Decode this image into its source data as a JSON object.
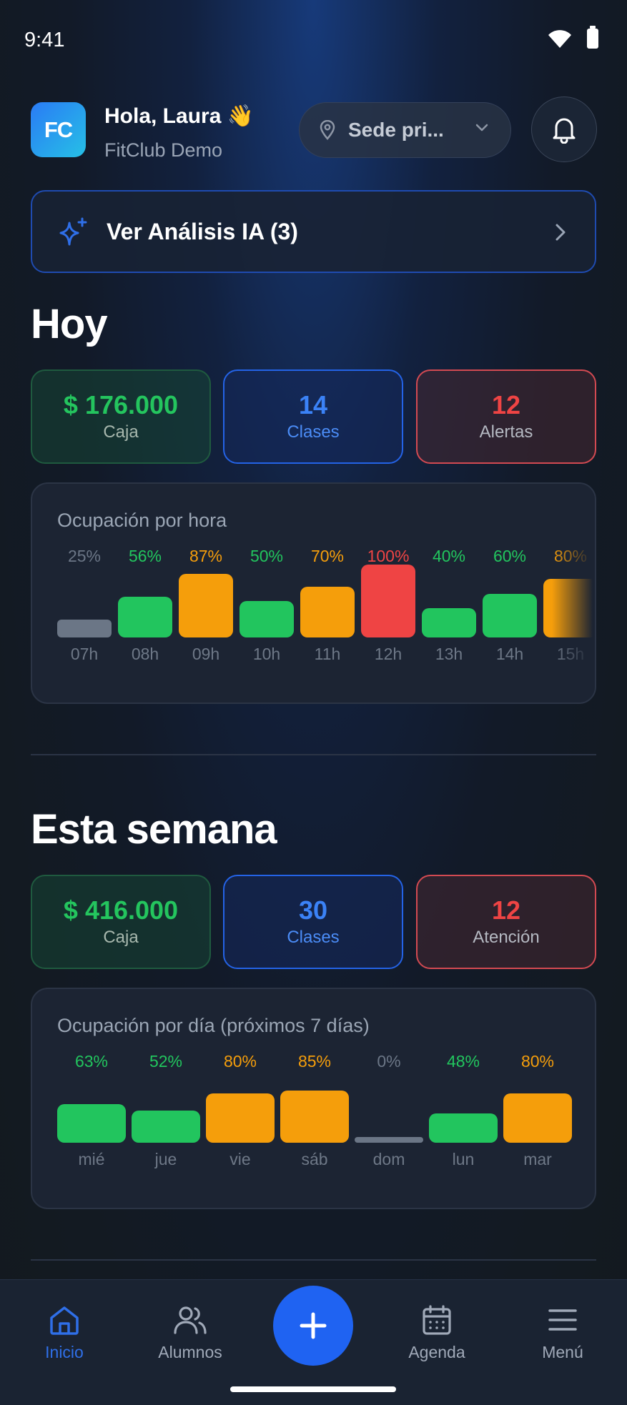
{
  "status_bar": {
    "time": "9:41"
  },
  "header": {
    "logo_text": "FC",
    "greeting": "Hola, Laura 👋",
    "org_name": "FitClub Demo",
    "location_select": "Sede pri..."
  },
  "ai_banner": {
    "label": "Ver Análisis IA (3)"
  },
  "today": {
    "title": "Hoy",
    "stats": [
      {
        "value": "$ 176.000",
        "label": "Caja",
        "color": "#24c55e"
      },
      {
        "value": "14",
        "label": "Clases",
        "color": "#3b82f6"
      },
      {
        "value": "12",
        "label": "Alertas",
        "color": "#ef4444"
      }
    ]
  },
  "week": {
    "title": "Esta semana",
    "stats": [
      {
        "value": "$ 416.000",
        "label": "Caja",
        "color": "#24c55e"
      },
      {
        "value": "30",
        "label": "Clases",
        "color": "#3b82f6"
      },
      {
        "value": "12",
        "label": "Atención",
        "color": "#ef4444"
      }
    ]
  },
  "colors": {
    "low": "#6b7686",
    "green": "#22c55e",
    "orange": "#f59e0b",
    "red": "#ef4444",
    "accent": "#1f63f2"
  },
  "chart_data": [
    {
      "type": "bar",
      "title": "Ocupación por hora",
      "categories": [
        "07h",
        "08h",
        "09h",
        "10h",
        "11h",
        "12h",
        "13h",
        "14h",
        "15h"
      ],
      "values": [
        25,
        56,
        87,
        50,
        70,
        100,
        40,
        60,
        80
      ],
      "value_labels": [
        "25%",
        "56%",
        "87%",
        "50%",
        "70%",
        "100%",
        "40%",
        "60%",
        "80%"
      ],
      "ylim": [
        0,
        100
      ],
      "grid": false
    },
    {
      "type": "bar",
      "title": "Ocupación por día (próximos 7 días)",
      "categories": [
        "mié",
        "jue",
        "vie",
        "sáb",
        "dom",
        "lun",
        "mar"
      ],
      "values": [
        63,
        52,
        80,
        85,
        0,
        48,
        80
      ],
      "value_labels": [
        "63%",
        "52%",
        "80%",
        "85%",
        "0%",
        "48%",
        "80%"
      ],
      "ylim": [
        0,
        100
      ],
      "grid": false
    }
  ],
  "bottom_nav": {
    "items": [
      {
        "label": "Inicio",
        "icon": "home-icon",
        "active": true
      },
      {
        "label": "Alumnos",
        "icon": "users-icon",
        "active": false
      },
      {
        "label": "Agenda",
        "icon": "calendar-icon",
        "active": false
      },
      {
        "label": "Menú",
        "icon": "menu-icon",
        "active": false
      }
    ],
    "fab_icon": "plus-icon"
  }
}
